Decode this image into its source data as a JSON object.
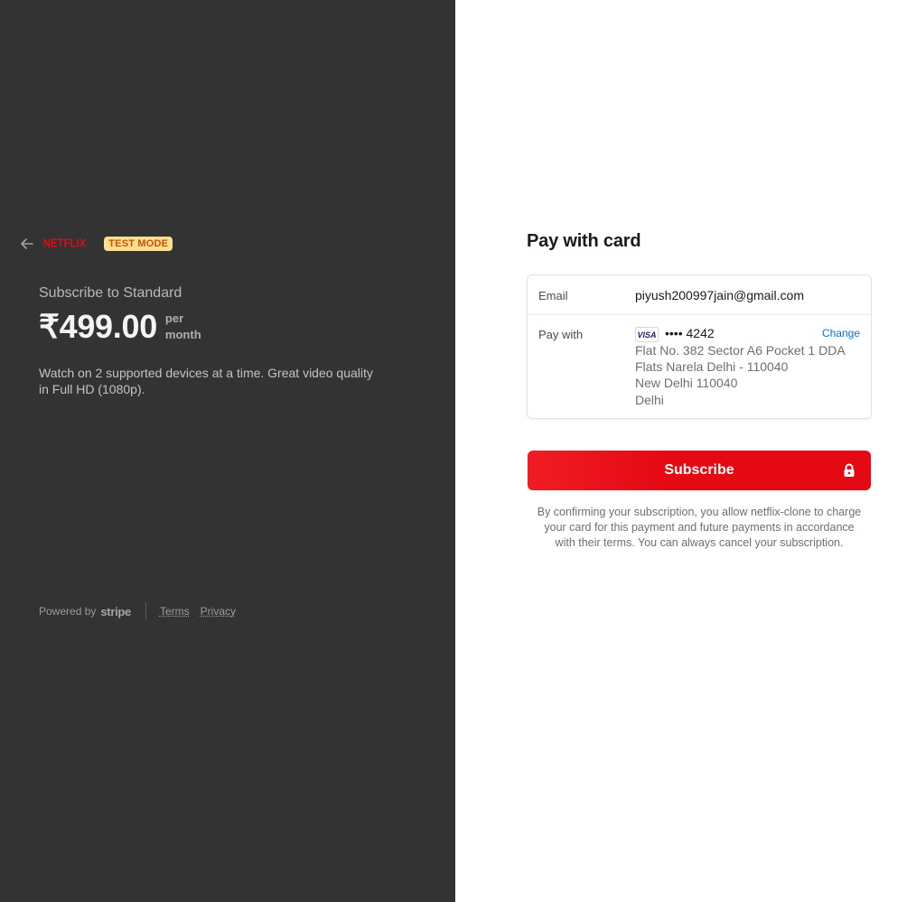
{
  "summary": {
    "brand": "NETFLIX",
    "test_badge": "TEST MODE",
    "product_name": "Subscribe to Standard",
    "price": "₹499.00",
    "period_line1": "per",
    "period_line2": "month",
    "description": "Watch on 2 supported devices at a time. Great video quality in Full HD (1080p).",
    "icons": {
      "back": "arrow-left-icon"
    }
  },
  "footer": {
    "powered_by": "Powered by",
    "stripe": "stripe",
    "terms": "Terms",
    "privacy": "Privacy"
  },
  "payment": {
    "title": "Pay with card",
    "email_label": "Email",
    "email_value": "piyush200997jain@gmail.com",
    "pay_with_label": "Pay with",
    "card_brand": "VISA",
    "card_last4": "•••• 4242",
    "change_label": "Change",
    "address_lines": [
      "Flat No. 382 Sector A6 Pocket 1 DDA",
      "Flats Narela Delhi - 110040",
      "New Delhi 110040",
      "Delhi"
    ]
  },
  "subscribe": {
    "label": "Subscribe",
    "icon": "lock-icon",
    "terms": "By confirming your subscription, you allow netflix-clone to charge your card for this payment and future payments in accordance with their terms. You can always cancel your subscription."
  },
  "colors": {
    "left_bg": "#333333",
    "accent": "#e50914",
    "link": "#0570de",
    "badge_bg": "#ffde92",
    "badge_text": "#bb5504"
  }
}
